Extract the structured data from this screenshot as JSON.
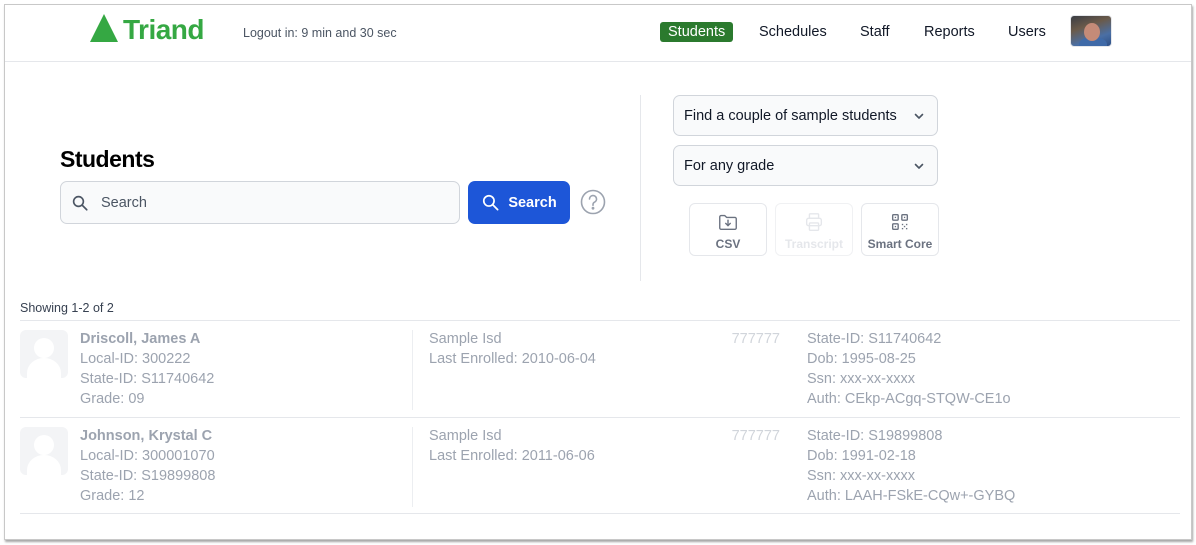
{
  "header": {
    "brand": "Triand",
    "brand_color": "#35a843",
    "logout_text": "Logout in: 9 min and 30 sec",
    "nav": [
      {
        "label": "Students",
        "active": true
      },
      {
        "label": "Schedules",
        "active": false
      },
      {
        "label": "Staff",
        "active": false
      },
      {
        "label": "Reports",
        "active": false
      },
      {
        "label": "Users",
        "active": false
      }
    ],
    "active_color": "#2b7a2e",
    "avatar_icon": "user-photo"
  },
  "search": {
    "title": "Students",
    "placeholder": "Search",
    "value": "",
    "button_label": "Search",
    "button_color": "#1d56d8",
    "help_icon": "question-circle-icon"
  },
  "filters": {
    "sample_select": "Find a couple of sample students",
    "grade_select": "For any grade"
  },
  "tools": [
    {
      "label": "CSV",
      "icon": "folder-download-icon",
      "enabled": true
    },
    {
      "label": "Transcript",
      "icon": "printer-icon",
      "enabled": false
    },
    {
      "label": "Smart Core",
      "icon": "qr-code-icon",
      "enabled": true
    }
  ],
  "results": {
    "showing": "Showing 1-2 of 2",
    "students": [
      {
        "name": "Driscoll, James A",
        "local_id": "Local-ID: 300222",
        "state_id": "State-ID: S11740642",
        "grade": "Grade: 09",
        "district": "Sample Isd",
        "last_enrolled": "Last Enrolled: 2010-06-04",
        "code": "777777",
        "state_id_2": "State-ID: S11740642",
        "dob": "Dob: 1995-08-25",
        "ssn": "Ssn: xxx-xx-xxxx",
        "auth": "Auth: CEkp-ACgq-STQW-CE1o"
      },
      {
        "name": "Johnson, Krystal C",
        "local_id": "Local-ID: 300001070",
        "state_id": "State-ID: S19899808",
        "grade": "Grade: 12",
        "district": "Sample Isd",
        "last_enrolled": "Last Enrolled: 2011-06-06",
        "code": "777777",
        "state_id_2": "State-ID: S19899808",
        "dob": "Dob: 1991-02-18",
        "ssn": "Ssn: xxx-xx-xxxx",
        "auth": "Auth: LAAH-FSkE-CQw+-GYBQ"
      }
    ]
  }
}
